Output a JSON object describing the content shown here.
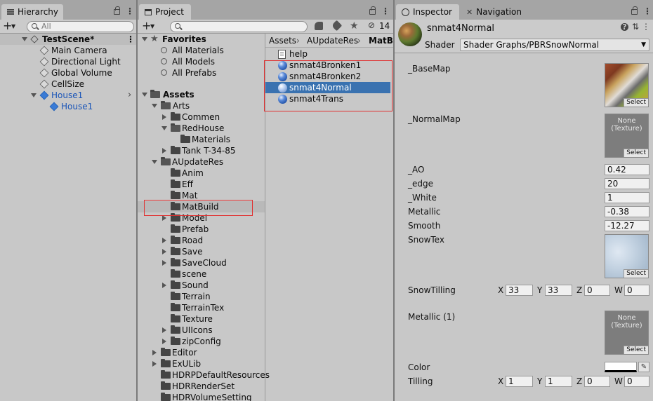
{
  "hierarchy": {
    "tab": "Hierarchy",
    "search_placeholder": "All",
    "scene": "TestScene*",
    "items": [
      "Main Camera",
      "Directional Light",
      "Global Volume",
      "CellSize",
      "House1",
      "House1"
    ]
  },
  "project": {
    "tab": "Project",
    "favorites_label": "Favorites",
    "favorites": [
      "All Materials",
      "All Models",
      "All Prefabs"
    ],
    "assets_label": "Assets",
    "tree": [
      "Arts",
      "Commen",
      "RedHouse",
      "Materials",
      "Tank T-34-85",
      "AUpdateRes",
      "Anim",
      "Eff",
      "Mat",
      "MatBuild",
      "Model",
      "Prefab",
      "Road",
      "Save",
      "SaveCloud",
      "scene",
      "Sound",
      "Terrain",
      "TerrainTex",
      "Texture",
      "UIIcons",
      "zipConfig",
      "Editor",
      "ExULib",
      "HDRPDefaultResources",
      "HDRRenderSet",
      "HDRVolumeSetting"
    ],
    "hidden_count": "14",
    "breadcrumb": [
      "Assets",
      "AUpdateRes",
      "MatBuil"
    ],
    "files": [
      "help",
      "snmat4Bronken1",
      "snmat4Bronken2",
      "snmat4Normal",
      "snmat4Trans"
    ]
  },
  "inspector": {
    "tab": "Inspector",
    "nav_tab": "Navigation",
    "material_name": "snmat4Normal",
    "shader_label": "Shader",
    "shader_value": "Shader Graphs/PBRSnowNormal",
    "props": {
      "basemap": "_BaseMap",
      "normalmap": "_NormalMap",
      "ao": "_AO",
      "edge": "_edge",
      "white": "_White",
      "metallic": "Metallic",
      "smooth": "Smooth",
      "snowtex": "SnowTex",
      "snowtilling": "SnowTilling",
      "metallic1": "Metallic (1)",
      "color": "Color",
      "tilling": "Tilling"
    },
    "values": {
      "ao": "0.42",
      "edge": "20",
      "white": "1",
      "metallic": "-0.38",
      "smooth": "-12.27"
    },
    "snowtilling": {
      "x": "33",
      "y": "33",
      "z": "0",
      "w": "0"
    },
    "tilling": {
      "x": "1",
      "y": "1",
      "z": "0",
      "w": "0"
    },
    "axis": {
      "x": "X",
      "y": "Y",
      "z": "Z",
      "w": "W"
    },
    "select_label": "Select",
    "none_texture_l1": "None",
    "none_texture_l2": "(Texture)"
  }
}
